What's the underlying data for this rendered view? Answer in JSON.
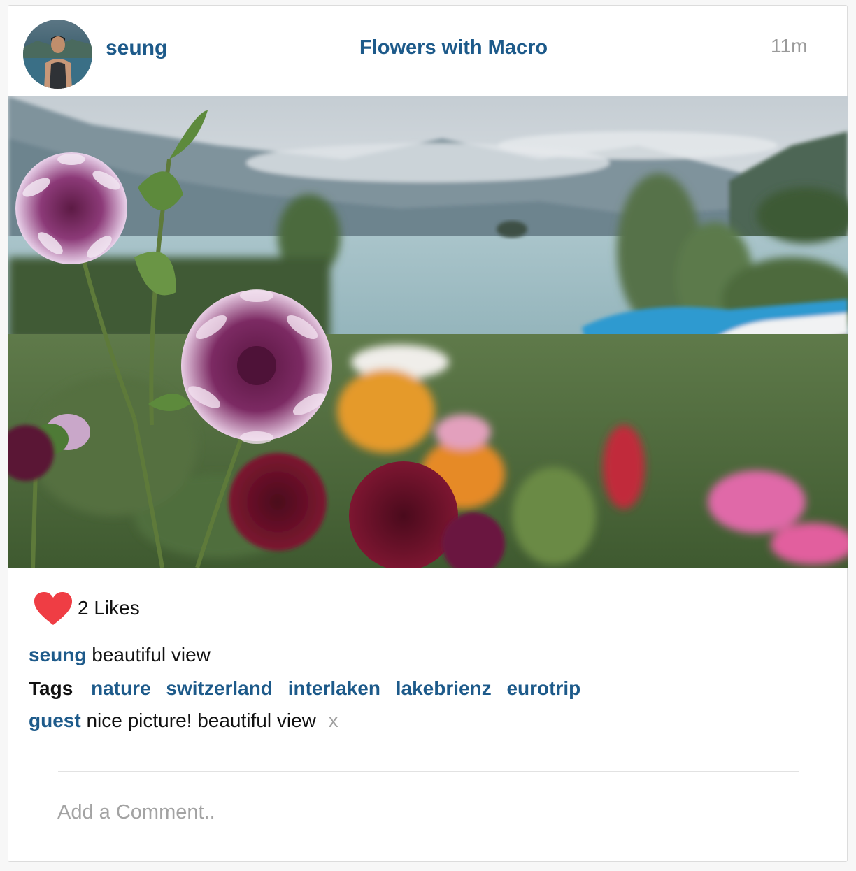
{
  "post": {
    "author": "seung",
    "title": "Flowers with Macro",
    "time_ago": "11m"
  },
  "likes": {
    "count_label": "2 Likes",
    "icon": "heart-icon",
    "color": "#ef3d44"
  },
  "caption": {
    "author": "seung",
    "text": "beautiful view"
  },
  "tags": {
    "label": "Tags",
    "items": [
      "nature",
      "switzerland",
      "interlaken",
      "lakebrienz",
      "eurotrip"
    ]
  },
  "comments": [
    {
      "author": "guest",
      "text": "nice picture! beautiful view",
      "delete_label": "x"
    }
  ],
  "comment_input": {
    "placeholder": "Add a Comment.."
  },
  "colors": {
    "link": "#1d5a8a",
    "muted": "#9a9a9a"
  }
}
